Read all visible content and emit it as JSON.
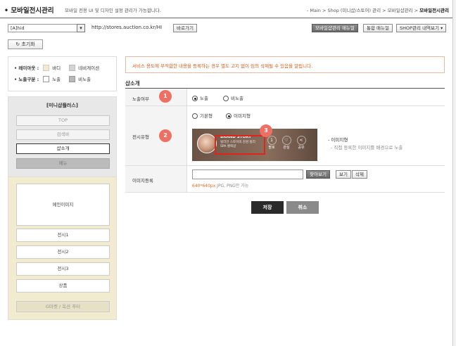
{
  "header": {
    "title": "• 모바일전시관리",
    "desc": "모바일 전용 UI 및 디자인 설정 관리가 가능합니다.",
    "crumb_prefix": "- Main > Shop (미니샵/스토어) 관리 > 모바일샵관리 > ",
    "crumb_current": "모바일전시관리"
  },
  "toolbar": {
    "select_value": "[A]hid",
    "url": "http://stores.auction.co.kr/HI",
    "copy_label": "바로가기",
    "manual_label": "모바일샵관리 매뉴얼",
    "integrated_label": "통합 매뉴얼",
    "shop_label": "SHOP관리 내역보기 ▾"
  },
  "reset_label": "↻ 초기화",
  "legend": {
    "layout_label": "• 레이아웃 :",
    "exposure_label": "• 노출구분 :",
    "items": {
      "bg": "바디",
      "nav": "네비게이션",
      "show": "노출",
      "hide": "비노출"
    },
    "colors": {
      "bg": "#f4ecc8",
      "nav": "#d4d4d4",
      "show": "#ffffff",
      "hide": "#b8b8b8"
    }
  },
  "sidebar": {
    "title": "[미니샵플러스]",
    "top_items": [
      "TOP",
      "검색바",
      "샵소개",
      "메뉴"
    ],
    "main_image": "메인이미지",
    "display_items": [
      "전시1",
      "전시2",
      "전시3",
      "상품"
    ],
    "footer": "G마켓 / 옥션 푸터"
  },
  "notice": "서비스 용도에 부적합한 내용을 등록하는 경우 별도 고지 없이 임의 삭제될 수 있음을 알립니다.",
  "section_title": "샵소개",
  "rows": {
    "exposure": {
      "label": "노출여부",
      "badge": "1",
      "options": [
        "노출",
        "비노출"
      ],
      "selected": 0
    },
    "display_type": {
      "label": "전시유형",
      "badge": "2",
      "options": [
        "기본형",
        "이미지형"
      ],
      "selected": 1,
      "desc_title": "- 이미지형",
      "desc_sub": "- 직접 등록한 이미지를 배경으로 노출"
    },
    "image": {
      "label": "이미지등록",
      "find_label": "찾아보기",
      "view_label": "보기",
      "delete_label": "삭제",
      "hint_size": "640*640px",
      "hint_rest": " JPG, PNG만 가능"
    }
  },
  "banner": {
    "title": "BRAND STORY",
    "sub1": "릴리안 스토어의 감성 릴리",
    "sub2": "SPA 셀렉샵",
    "badge": "3",
    "stats": [
      {
        "v": "1",
        "l": "팔로"
      },
      {
        "v": "♡",
        "l": "관심"
      },
      {
        "v": "<",
        "l": "공유"
      }
    ]
  },
  "actions": {
    "save": "저장",
    "cancel": "취소"
  }
}
